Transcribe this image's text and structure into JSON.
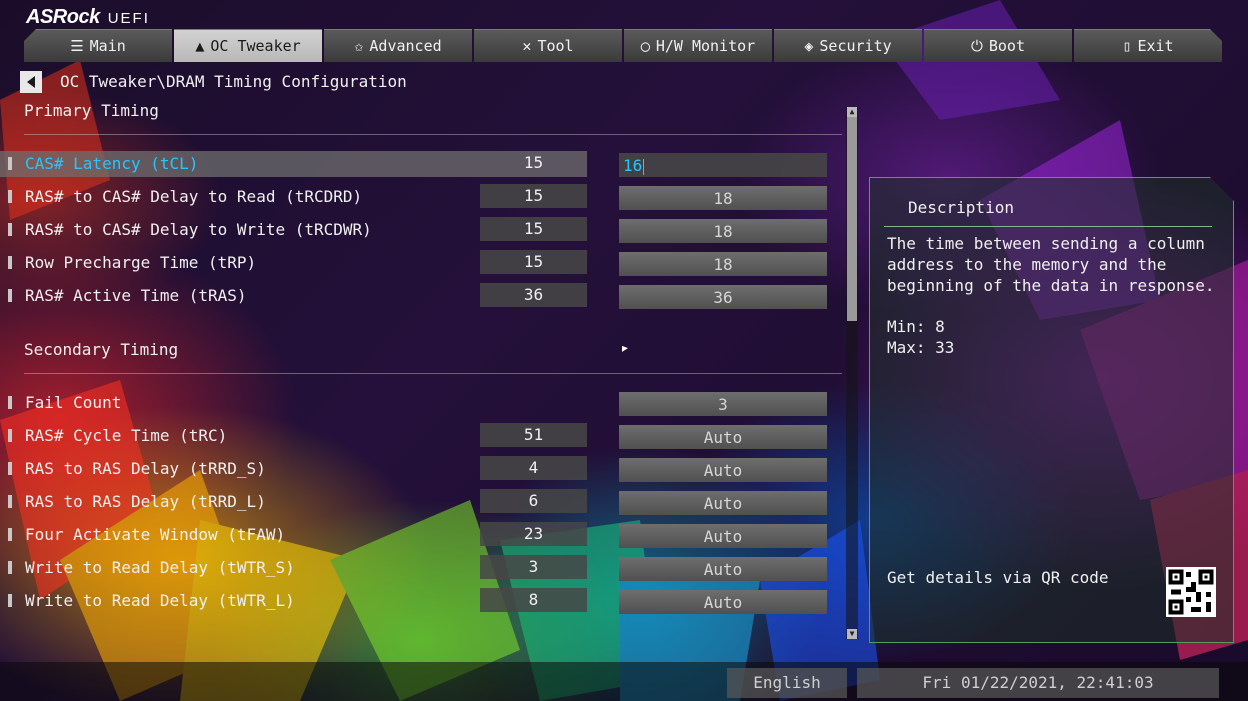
{
  "brand": {
    "name": "ASRock",
    "suffix": "UEFI"
  },
  "tabs": [
    {
      "label": "Main",
      "icon": "list-icon"
    },
    {
      "label": "OC Tweaker",
      "icon": "rocket-icon",
      "active": true
    },
    {
      "label": "Advanced",
      "icon": "star-icon"
    },
    {
      "label": "Tool",
      "icon": "wrench-icon"
    },
    {
      "label": "H/W Monitor",
      "icon": "gauge-icon"
    },
    {
      "label": "Security",
      "icon": "shield-icon"
    },
    {
      "label": "Boot",
      "icon": "power-icon"
    },
    {
      "label": "Exit",
      "icon": "exit-door-icon"
    }
  ],
  "breadcrumb": "OC Tweaker\\DRAM Timing Configuration",
  "sections": {
    "primary": "Primary Timing",
    "secondary": "Secondary Timing"
  },
  "primary_rows": [
    {
      "label": "CAS# Latency (tCL)",
      "current": "15",
      "value": "16",
      "selected": true
    },
    {
      "label": "RAS# to CAS# Delay to Read  (tRCDRD)",
      "current": "15",
      "value": "18"
    },
    {
      "label": "RAS# to CAS# Delay to Write (tRCDWR)",
      "current": "15",
      "value": "18"
    },
    {
      "label": "Row Precharge Time (tRP)",
      "current": "15",
      "value": "18"
    },
    {
      "label": "RAS# Active Time (tRAS)",
      "current": "36",
      "value": "36"
    }
  ],
  "secondary_rows": [
    {
      "label": "Fail Count",
      "current": "",
      "value": "3"
    },
    {
      "label": "RAS# Cycle Time (tRC)",
      "current": "51",
      "value": "Auto"
    },
    {
      "label": "RAS to RAS Delay (tRRD_S)",
      "current": "4",
      "value": "Auto"
    },
    {
      "label": "RAS to RAS Delay (tRRD_L)",
      "current": "6",
      "value": "Auto"
    },
    {
      "label": "Four Activate Window (tFAW)",
      "current": "23",
      "value": "Auto"
    },
    {
      "label": "Write to Read Delay (tWTR_S)",
      "current": "3",
      "value": "Auto"
    },
    {
      "label": "Write to Read Delay (tWTR_L)",
      "current": "8",
      "value": "Auto"
    }
  ],
  "description": {
    "title": "Description",
    "text": "The time between sending a column address to the memory and the beginning of the data in response.",
    "min": "Min: 8",
    "max": "Max: 33",
    "qr_text": "Get details via QR code"
  },
  "footer": {
    "language": "English",
    "datetime": "Fri 01/22/2021, 22:41:03"
  }
}
